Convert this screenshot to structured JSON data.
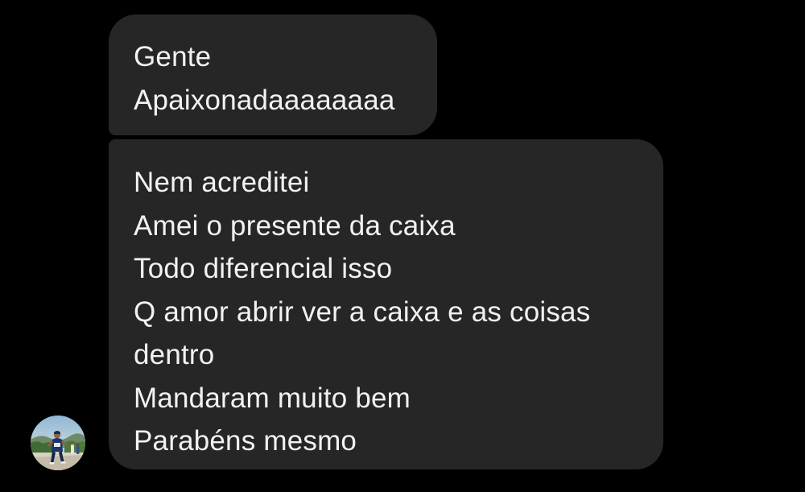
{
  "thread": {
    "messages": [
      {
        "lines": [
          "Gente",
          "Apaixonadaaaaaaaa"
        ]
      },
      {
        "lines": [
          "Nem acreditei",
          "Amei o presente da caixa",
          "Todo diferencial isso",
          "Q amor abrir ver a caixa e as coisas",
          "dentro",
          "Mandaram muito bem",
          "Parabéns mesmo"
        ]
      }
    ]
  },
  "colors": {
    "background": "#000000",
    "bubble": "#262626",
    "text": "#f2f2f2"
  },
  "avatar": {
    "icon": "profile-photo-avatar"
  }
}
